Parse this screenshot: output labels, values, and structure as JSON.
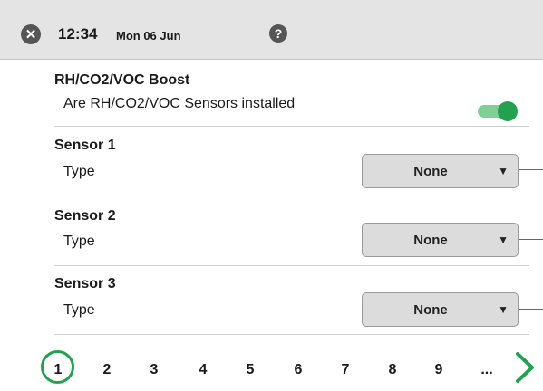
{
  "header": {
    "time": "12:34",
    "date": "Mon 06 Jun",
    "close_icon": "close-icon",
    "help_icon": "help-icon",
    "help_glyph": "?"
  },
  "boost": {
    "title": "RH/CO2/VOC Boost",
    "question": "Are RH/CO2/VOC Sensors installed",
    "toggle_on": true
  },
  "sensors": [
    {
      "title": "Sensor 1",
      "label": "Type",
      "value": "None"
    },
    {
      "title": "Sensor 2",
      "label": "Type",
      "value": "None"
    },
    {
      "title": "Sensor 3",
      "label": "Type",
      "value": "None"
    }
  ],
  "pagination": {
    "pages": [
      "1",
      "2",
      "3",
      "4",
      "5",
      "6",
      "7",
      "8",
      "9",
      "..."
    ],
    "active": "1",
    "next_icon": "chevron-right-icon"
  },
  "colors": {
    "accent": "#24a150",
    "toggle_track": "#7fcf97",
    "header_bg": "#e4e4e4",
    "select_bg": "#dcdcdc"
  }
}
